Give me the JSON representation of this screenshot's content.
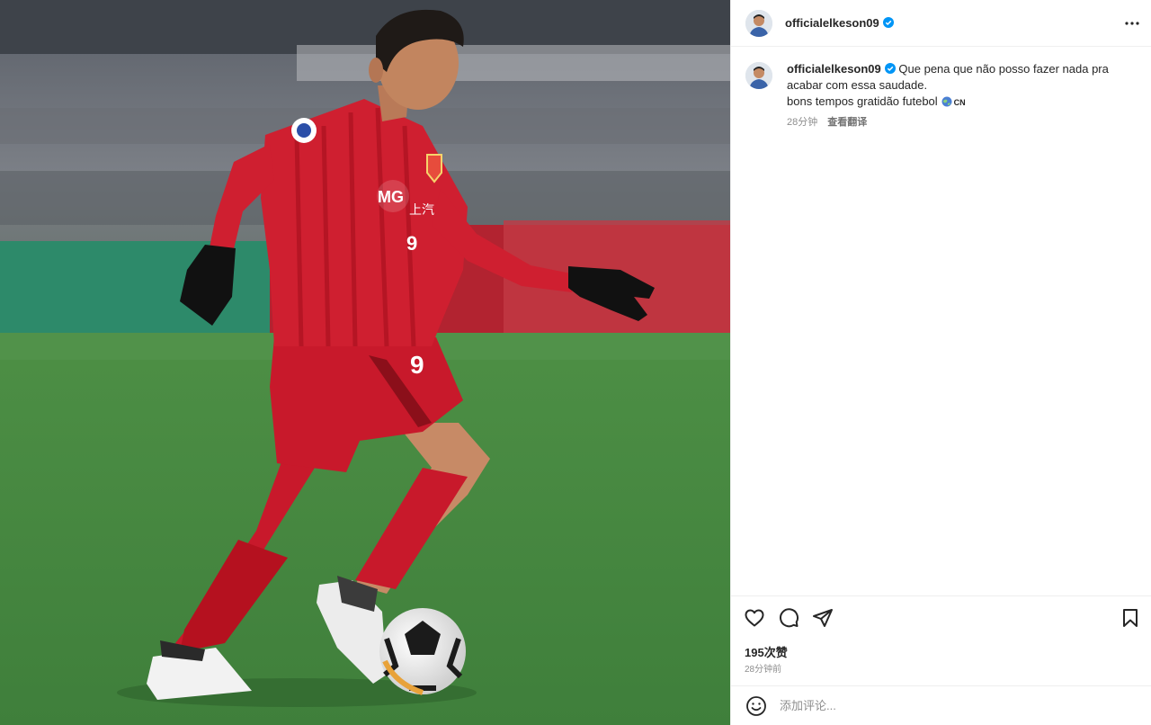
{
  "post": {
    "username": "officialelkeson09",
    "verified": true,
    "photo_subject": "soccer-player-dribbling-ball"
  },
  "header": {
    "more_icon": "more-horizontal-icon"
  },
  "caption": {
    "username": "officialelkeson09",
    "text": "Que pena que não posso fazer nada pra acabar com essa saudade.",
    "text_line2": "bons tempos gratidão futebol",
    "flag_label": "CN",
    "time": "28分钟",
    "translate_label": "查看翻译"
  },
  "actions": {
    "like_icon": "heart-icon",
    "comment_icon": "comment-icon",
    "share_icon": "paper-plane-icon",
    "save_icon": "bookmark-icon"
  },
  "stats": {
    "likes": "195次赞",
    "time_ago": "28分钟前"
  },
  "comment_box": {
    "placeholder": "添加评论...",
    "emoji_icon": "smiley-icon"
  },
  "colors": {
    "text": "#262626",
    "muted": "#8e8e8e",
    "verified": "#0095f6",
    "border": "#efefef",
    "jersey": "#c8102e"
  }
}
